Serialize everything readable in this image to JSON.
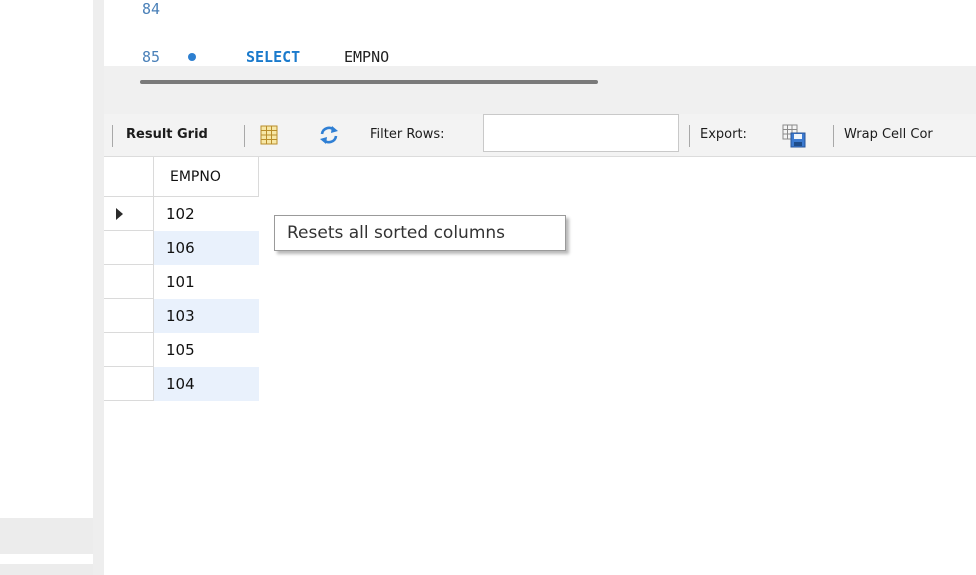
{
  "editor": {
    "lines": [
      {
        "number": "84",
        "code_keyword": "",
        "code_text": ""
      },
      {
        "number": "85",
        "code_keyword": "SELECT",
        "code_text": "EMPNO"
      }
    ]
  },
  "toolbar": {
    "result_grid_label": "Result Grid",
    "filter_rows_label": "Filter Rows:",
    "filter_rows_value": "",
    "export_label": "Export:",
    "wrap_cell_label": "Wrap Cell Cor"
  },
  "grid": {
    "columns": [
      "EMPNO"
    ],
    "rows": [
      {
        "EMPNO": "102",
        "current": true
      },
      {
        "EMPNO": "106",
        "current": false
      },
      {
        "EMPNO": "101",
        "current": false
      },
      {
        "EMPNO": "103",
        "current": false
      },
      {
        "EMPNO": "105",
        "current": false
      },
      {
        "EMPNO": "104",
        "current": false
      }
    ]
  },
  "tooltip": {
    "text": "Resets all sorted columns"
  },
  "colors": {
    "keyword": "#1a7acc",
    "line_number": "#4a80b8",
    "row_alt": "#e9f1fc",
    "bullet": "#2d7fd0"
  },
  "icons": {
    "grid_view": "grid-view-icon",
    "reset_sort": "refresh-arrows-icon",
    "export": "export-floppy-icon",
    "current_row": "row-pointer-icon",
    "statement_marker": "bullet-dot-icon"
  }
}
